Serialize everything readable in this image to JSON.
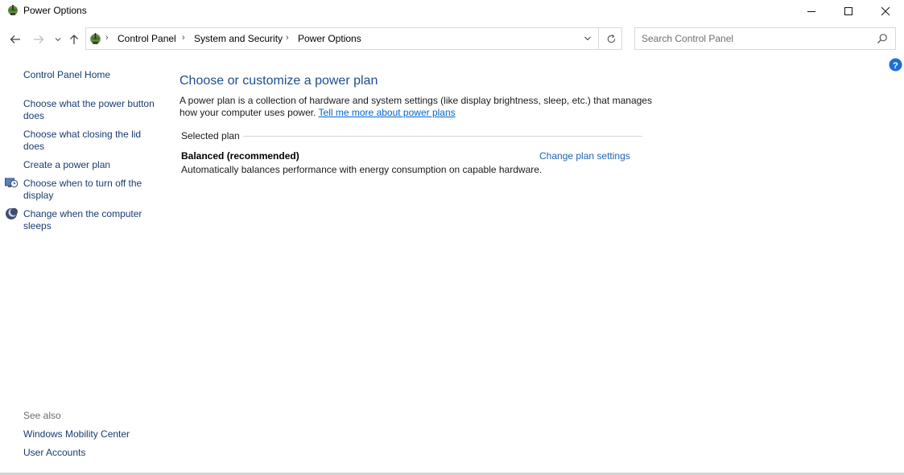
{
  "window": {
    "title": "Power Options"
  },
  "address": {
    "breadcrumbs": [
      "Control Panel",
      "System and Security",
      "Power Options"
    ]
  },
  "search": {
    "placeholder": "Search Control Panel"
  },
  "sidebar": {
    "home": "Control Panel Home",
    "tasks": [
      {
        "label": "Choose what the power button does",
        "icon": null
      },
      {
        "label": "Choose what closing the lid does",
        "icon": null
      },
      {
        "label": "Create a power plan",
        "icon": null
      },
      {
        "label": "Choose when to turn off the display",
        "icon": "display-clock-icon"
      },
      {
        "label": "Change when the computer sleeps",
        "icon": "moon-icon"
      }
    ],
    "see_also_label": "See also",
    "see_also": [
      "Windows Mobility Center",
      "User Accounts"
    ]
  },
  "main": {
    "heading": "Choose or customize a power plan",
    "description": "A power plan is a collection of hardware and system settings (like display brightness, sleep, etc.) that manages how your computer uses power.",
    "learn_more_link": "Tell me more about power plans",
    "section_label": "Selected plan",
    "plan": {
      "name": "Balanced (recommended)",
      "description": "Automatically balances performance with energy consumption on capable hardware.",
      "settings_link": "Change plan settings"
    }
  },
  "colors": {
    "heading": "#1e4e8c",
    "link": "#1e62b4",
    "help": "#1e6fd1"
  }
}
